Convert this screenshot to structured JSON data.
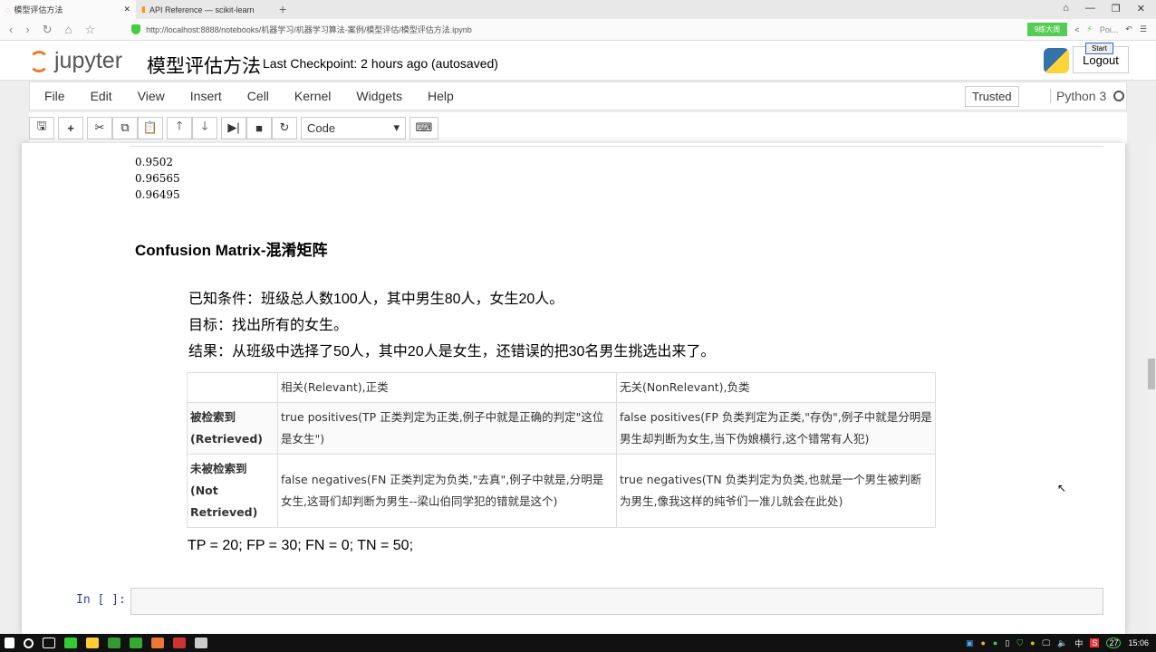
{
  "browser": {
    "tabs": [
      {
        "label": "模型评估方法",
        "active": true
      },
      {
        "label": "API Reference — scikit-learn",
        "active": false
      }
    ],
    "url": "http://localhost:8888/notebooks/机器学习/机器学习算法-案例/模型评估/模型评估方法.ipynb",
    "extension_badge": "9练大周",
    "popup_label": "Poi...",
    "popup_start": "Start"
  },
  "header": {
    "logo_text": "jupyter",
    "notebook_title": "模型评估方法",
    "checkpoint": "Last Checkpoint: 2 hours ago (autosaved)",
    "logout": "Logout"
  },
  "menu": {
    "items": [
      "File",
      "Edit",
      "View",
      "Insert",
      "Cell",
      "Kernel",
      "Widgets",
      "Help"
    ],
    "trusted": "Trusted",
    "kernel": "Python 3"
  },
  "toolbar": {
    "cell_type": "Code"
  },
  "output": {
    "lines": [
      "0.9502",
      "0.96565",
      "0.96495"
    ]
  },
  "markdown": {
    "heading": "Confusion Matrix-混淆矩阵",
    "paragraphs": [
      "已知条件：班级总人数100人，其中男生80人，女生20人。",
      "目标：找出所有的女生。",
      "结果：从班级中选择了50人，其中20人是女生，还错误的把30名男生挑选出来了。"
    ],
    "table": {
      "headers": [
        "",
        "相关(Relevant),正类",
        "无关(NonRelevant),负类"
      ],
      "rows": [
        [
          "被检索到 (Retrieved)",
          "true positives(TP 正类判定为正类,例子中就是正确的判定\"这位是女生\")",
          "false positives(FP 负类判定为正类,\"存伪\",例子中就是分明是男生却判断为女生,当下伪娘横行,这个错常有人犯)"
        ],
        [
          "未被检索到 (Not Retrieved)",
          "false negatives(FN 正类判定为负类,\"去真\",例子中就是,分明是女生,这哥们却判断为男生--梁山伯同学犯的错就是这个)",
          "true negatives(TN 负类判定为负类,也就是一个男生被判断为男生,像我这样的纯爷们一准儿就会在此处)"
        ]
      ]
    },
    "equation": "TP = 20; FP = 30; FN = 0; TN = 50;"
  },
  "input_cell": {
    "prompt": "In [ ]:"
  },
  "taskbar": {
    "ime": "中",
    "notifications": "27",
    "time": "15:06"
  }
}
